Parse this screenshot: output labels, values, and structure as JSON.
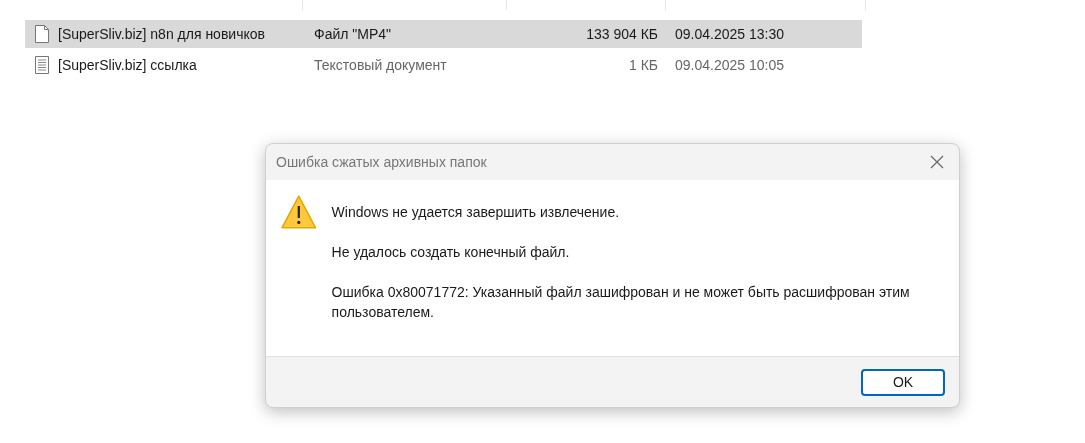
{
  "files": [
    {
      "name": "[SuperSliv.biz] n8n для новичков",
      "type": "Файл \"MP4\"",
      "size": "133 904 КБ",
      "date": "09.04.2025 13:30",
      "kind": "video",
      "selected": true
    },
    {
      "name": "[SuperSliv.biz] ссылка",
      "type": "Текстовый документ",
      "size": "1 КБ",
      "date": "09.04.2025 10:05",
      "kind": "text",
      "selected": false
    }
  ],
  "dialog": {
    "title": "Ошибка сжатых архивных папок",
    "messages": [
      "Windows не удается завершить извлечение.",
      "Не удалось создать конечный файл.",
      "Ошибка 0x80071772: Указанный файл зашифрован и не может быть расшифрован этим пользователем."
    ],
    "button": "OK"
  }
}
